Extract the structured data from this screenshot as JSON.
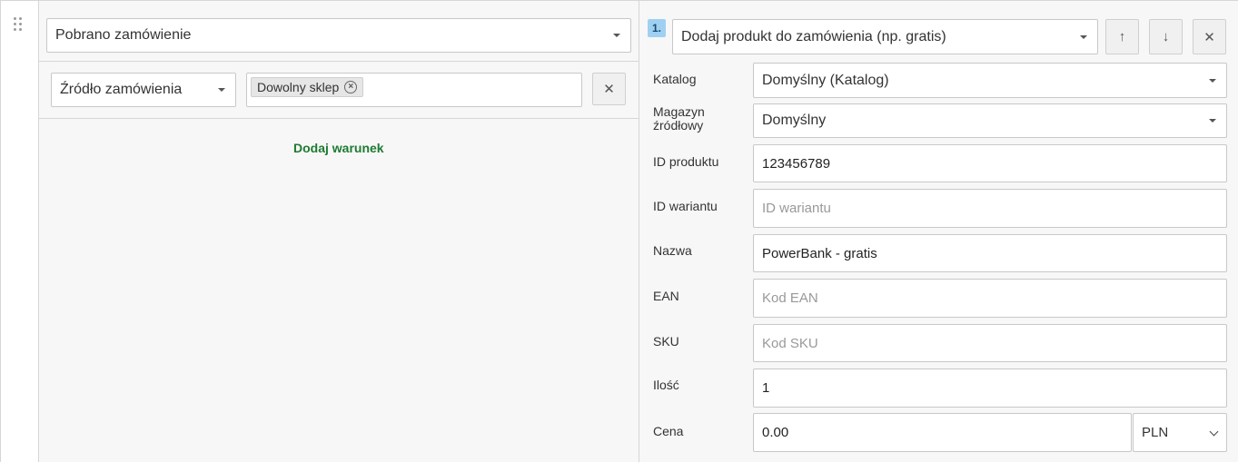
{
  "trigger": {
    "event_value": "Pobrano zamówienie"
  },
  "condition": {
    "field_value": "Źródło zamówienia",
    "tag_label": "Dowolny sklep",
    "remove_icon": "close-icon",
    "add_condition_label": "Dodaj warunek"
  },
  "action": {
    "index": "1.",
    "type_value": "Dodaj produkt do zamówienia (np. gratis)",
    "move_up_icon": "arrow-up-icon",
    "move_down_icon": "arrow-down-icon",
    "remove_icon": "close-icon",
    "fields": {
      "catalog": {
        "label": "Katalog",
        "value": "Domyślny (Katalog)"
      },
      "warehouse": {
        "label_line1": "Magazyn",
        "label_line2": "źródłowy",
        "value": "Domyślny"
      },
      "product_id": {
        "label": "ID produktu",
        "value": "123456789"
      },
      "variant_id": {
        "label": "ID wariantu",
        "placeholder": "ID wariantu"
      },
      "name": {
        "label": "Nazwa",
        "value": "PowerBank - gratis"
      },
      "ean": {
        "label": "EAN",
        "placeholder": "Kod EAN"
      },
      "sku": {
        "label": "SKU",
        "placeholder": "Kod SKU"
      },
      "quantity": {
        "label": "Ilość",
        "value": "1"
      },
      "price": {
        "label": "Cena",
        "value": "0.00",
        "currency": "PLN"
      }
    }
  },
  "colors": {
    "accent_green": "#1e7a32",
    "badge_blue": "#9fd0f2",
    "panel_bg": "#f7f7f7"
  }
}
